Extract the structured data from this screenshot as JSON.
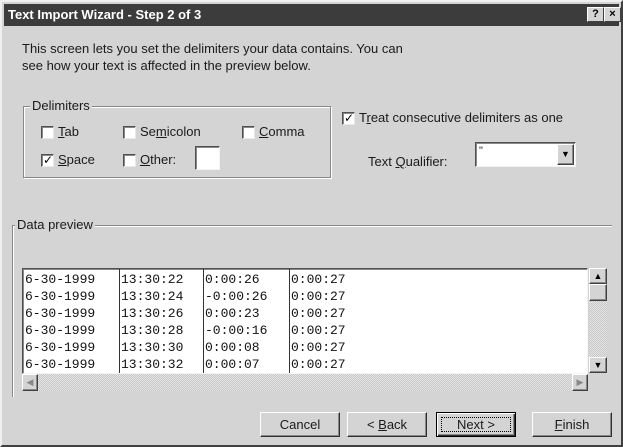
{
  "window": {
    "title": "Text Import Wizard - Step 2 of 3",
    "help_label": "?",
    "close_label": "×"
  },
  "intro": {
    "line1": "This screen lets you set the delimiters your data contains.  You can",
    "line2": "see how your text is affected in the preview below."
  },
  "delimiters": {
    "legend": "Delimiters",
    "tab": {
      "pre": "",
      "key": "T",
      "post": "ab",
      "checked": false
    },
    "semicolon": {
      "pre": "Se",
      "key": "m",
      "post": "icolon",
      "checked": false
    },
    "comma": {
      "pre": "",
      "key": "C",
      "post": "omma",
      "checked": false
    },
    "space": {
      "pre": "",
      "key": "S",
      "post": "pace",
      "checked": true
    },
    "other": {
      "pre": "",
      "key": "O",
      "post": "ther:",
      "checked": false,
      "value": ""
    },
    "check_glyph": "✓"
  },
  "consecutive": {
    "pre": "T",
    "key": "r",
    "post": "eat consecutive delimiters as one",
    "checked": true
  },
  "qualifier": {
    "label_pre": "Text ",
    "label_key": "Q",
    "label_post": "ualifier:",
    "value": "\"",
    "arrow": "▼"
  },
  "preview": {
    "legend": "Data preview",
    "rows": [
      [
        "6-30-1999",
        "13:30:22",
        "0:00:26",
        "0:00:27"
      ],
      [
        "6-30-1999",
        "13:30:24",
        "-0:00:26",
        "0:00:27"
      ],
      [
        "6-30-1999",
        "13:30:26",
        "0:00:23",
        "0:00:27"
      ],
      [
        "6-30-1999",
        "13:30:28",
        "-0:00:16",
        "0:00:27"
      ],
      [
        "6-30-1999",
        "13:30:30",
        "0:00:08",
        "0:00:27"
      ],
      [
        "6-30-1999",
        "13:30:32",
        "0:00:07",
        "0:00:27"
      ]
    ],
    "scroll_up": "▲",
    "scroll_down": "▼",
    "scroll_left": "◀",
    "scroll_right": "▶"
  },
  "buttons": {
    "cancel": {
      "pre": "Cancel",
      "key": "",
      "post": ""
    },
    "back": {
      "pre": "< ",
      "key": "B",
      "post": "ack"
    },
    "next": {
      "pre": "Next >",
      "key": "",
      "post": ""
    },
    "finish": {
      "pre": "",
      "key": "F",
      "post": "inish"
    }
  }
}
